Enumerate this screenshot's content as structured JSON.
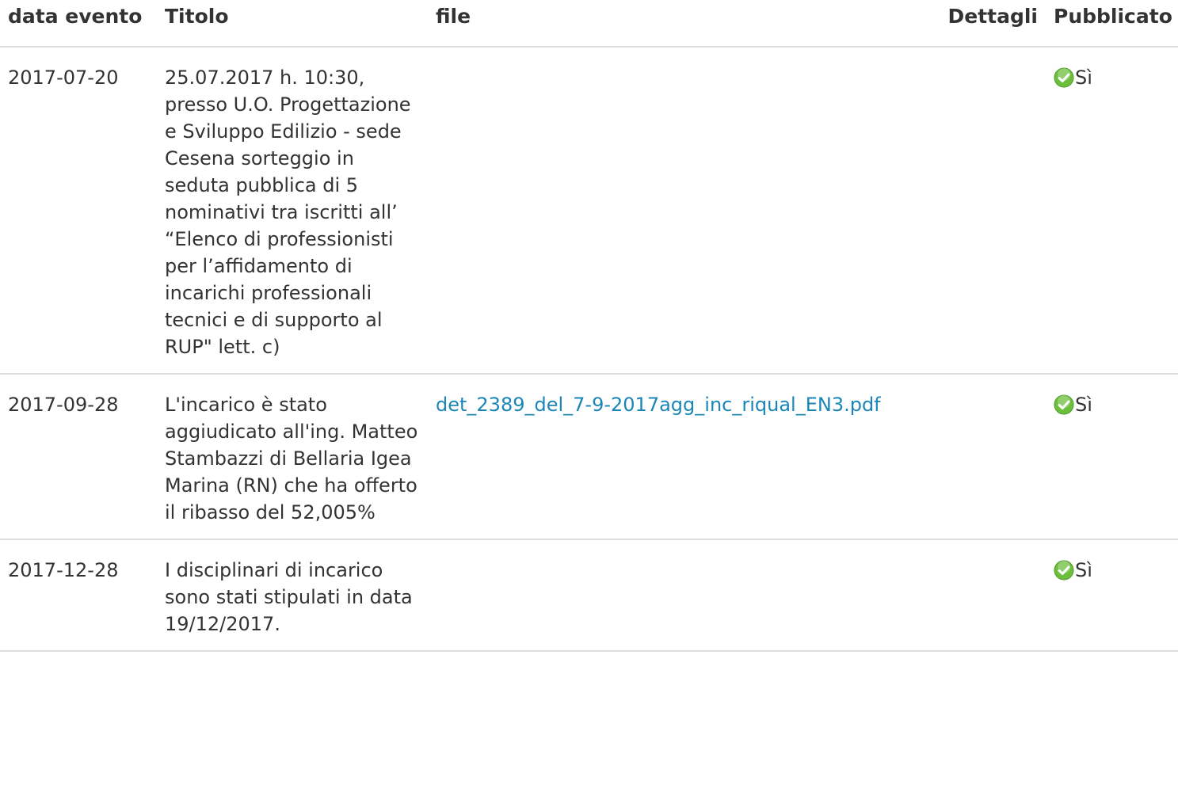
{
  "columns": {
    "date": "data evento",
    "title": "Titolo",
    "file": "file",
    "details": "Dettagli",
    "published": "Pubblicato"
  },
  "rows": [
    {
      "date": "2017-07-20",
      "title": "25.07.2017 h. 10:30, presso U.O. Progettazione e Sviluppo Edilizio - sede Cesena sorteggio in seduta pubblica di 5 nominativi tra iscritti all’ “Elenco di professionisti per l’affidamento di incarichi professionali tecnici e di supporto al RUP\" lett. c)",
      "file": "",
      "details": "",
      "published": "Sì",
      "published_icon": "check-circle-icon"
    },
    {
      "date": "2017-09-28",
      "title": "L'incarico è stato aggiudicato all'ing. Matteo Stambazzi di Bellaria Igea Marina (RN) che ha offerto il ribasso del 52,005%",
      "file": "det_2389_del_7-9-2017agg_inc_riqual_EN3.pdf",
      "details": "",
      "published": "Sì",
      "published_icon": "check-circle-icon"
    },
    {
      "date": "2017-12-28",
      "title": "I disciplinari di incarico sono stati stipulati in data 19/12/2017.",
      "file": "",
      "details": "",
      "published": "Sì",
      "published_icon": "check-circle-icon"
    }
  ],
  "colors": {
    "link": "#1a86b8",
    "text": "#333333",
    "border": "#dddddd",
    "ok_icon": "#6cbf3c"
  }
}
